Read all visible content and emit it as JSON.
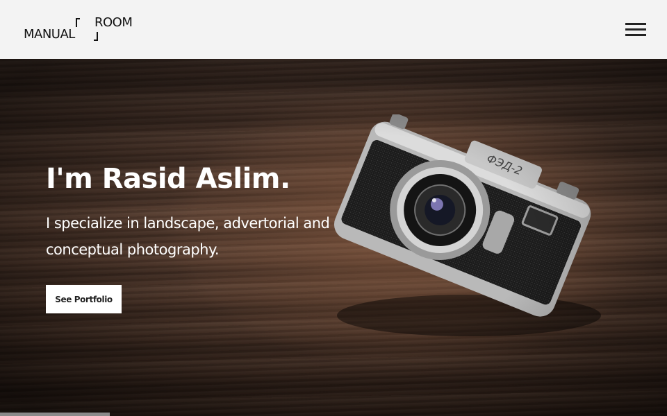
{
  "brand": {
    "left": "MANUAL",
    "right": "ROOM"
  },
  "nav": {
    "menu_icon": "hamburger-menu-icon"
  },
  "hero": {
    "title": "I'm Rasid Aslim.",
    "subtitle": "I specialize in landscape, advertorial and conceptual photography.",
    "cta_label": "See Portfolio",
    "image": "camera-on-wooden-table",
    "scroll_progress": 0.165
  },
  "colors": {
    "topbar_bg": "#f3f3f3",
    "text_dark": "#111111",
    "hero_text": "#ffffff"
  }
}
